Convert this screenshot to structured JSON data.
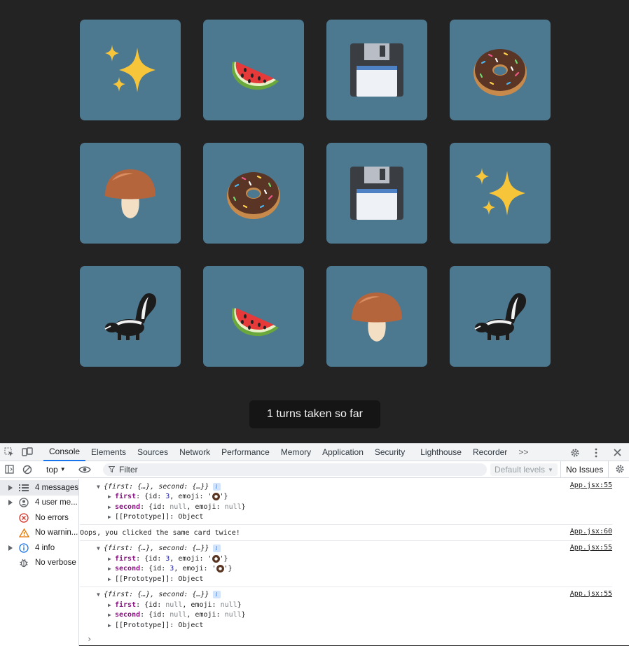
{
  "game": {
    "cards": [
      {
        "emoji": "sparkles"
      },
      {
        "emoji": "watermelon"
      },
      {
        "emoji": "floppy-disk"
      },
      {
        "emoji": "donut"
      },
      {
        "emoji": "mushroom"
      },
      {
        "emoji": "donut"
      },
      {
        "emoji": "floppy-disk"
      },
      {
        "emoji": "sparkles"
      },
      {
        "emoji": "skunk"
      },
      {
        "emoji": "watermelon"
      },
      {
        "emoji": "mushroom"
      },
      {
        "emoji": "skunk"
      }
    ],
    "status": "1 turns taken so far",
    "colors": {
      "background": "#232323",
      "card": "#4c7890",
      "status_bg": "#151515"
    }
  },
  "devtools": {
    "tabs": [
      "Console",
      "Elements",
      "Sources",
      "Network",
      "Performance",
      "Memory",
      "Application",
      "Security",
      "Lighthouse",
      "Recorder"
    ],
    "active_tab": "Console",
    "more": ">>",
    "context": "top",
    "filter_placeholder": "Filter",
    "levels": "Default levels",
    "issues": "No Issues",
    "sidebar": [
      {
        "label": "4 messages",
        "icon": "list-icon",
        "expandable": true
      },
      {
        "label": "4 user me...",
        "icon": "user-icon",
        "expandable": true
      },
      {
        "label": "No errors",
        "icon": "error-icon",
        "expandable": false
      },
      {
        "label": "No warnin...",
        "icon": "warning-icon",
        "expandable": false
      },
      {
        "label": "4 info",
        "icon": "info-icon",
        "expandable": true
      },
      {
        "label": "No verbose",
        "icon": "bug-icon",
        "expandable": false
      }
    ],
    "messages": [
      {
        "summary": "{first: {…}, second: {…}}",
        "source": "App.jsx:55",
        "first_key": "first",
        "first_id": "3",
        "second_key": "second",
        "second_id": "null",
        "second_emoji": "null",
        "proto": "[[Prototype]]",
        "proto_val": "Object"
      },
      {
        "text": "Oops, you clicked the same card twice!",
        "source": "App.jsx:60"
      },
      {
        "summary": "{first: {…}, second: {…}}",
        "source": "App.jsx:55",
        "first_key": "first",
        "first_id": "3",
        "second_key": "second",
        "second_id": "3",
        "proto": "[[Prototype]]",
        "proto_val": "Object"
      },
      {
        "summary": "{first: {…}, second: {…}}",
        "source": "App.jsx:55",
        "first_key": "first",
        "first_id": "null",
        "first_emoji": "null",
        "second_key": "second",
        "second_id": "null",
        "second_emoji": "null",
        "proto": "[[Prototype]]",
        "proto_val": "Object"
      }
    ],
    "labels": {
      "id": "id",
      "emoji": "emoji"
    },
    "prompt": "›"
  }
}
